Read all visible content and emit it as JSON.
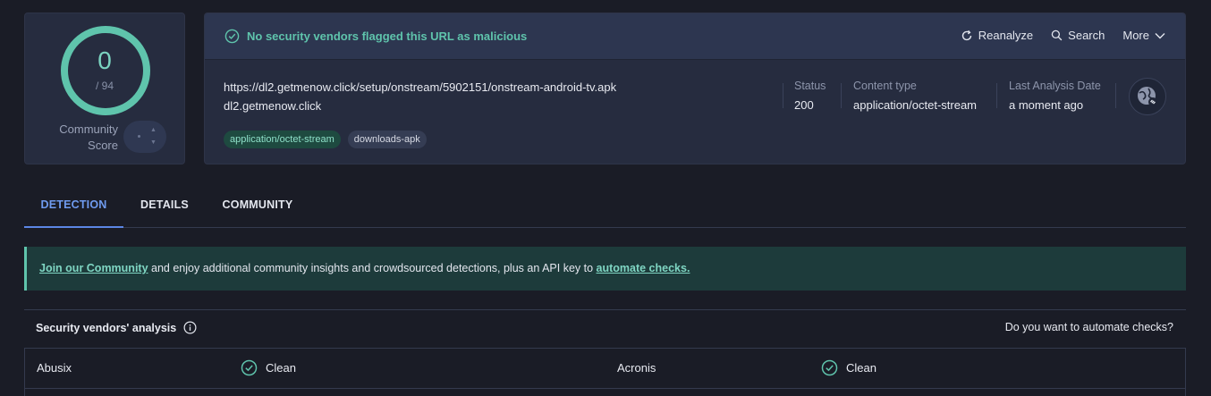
{
  "score": {
    "detections": "0",
    "total": "/ 94",
    "community_label_1": "Community",
    "community_label_2": "Score",
    "ring_color": "#5fc4ac"
  },
  "header": {
    "verdict": "No security vendors flagged this URL as malicious",
    "actions": {
      "reanalyze": "Reanalyze",
      "search": "Search",
      "more": "More"
    }
  },
  "target": {
    "url": "https://dl2.getmenow.click/setup/onstream/5902151/onstream-android-tv.apk",
    "domain": "dl2.getmenow.click",
    "tags": [
      "application/octet-stream",
      "downloads-apk"
    ]
  },
  "meta": {
    "status_label": "Status",
    "status_value": "200",
    "content_type_label": "Content type",
    "content_type_value": "application/octet-stream",
    "last_analysis_label": "Last Analysis Date",
    "last_analysis_value": "a moment ago"
  },
  "tabs": [
    "DETECTION",
    "DETAILS",
    "COMMUNITY"
  ],
  "banner": {
    "link1": "Join our Community",
    "middle": " and enjoy additional community insights and crowdsourced detections, plus an API key to ",
    "link2": "automate checks."
  },
  "vendors": {
    "title": "Security vendors' analysis",
    "automate_question": "Do you want to automate checks?",
    "rows": [
      {
        "left_name": "Abusix",
        "left_result": "Clean",
        "right_name": "Acronis",
        "right_result": "Clean"
      }
    ]
  },
  "colors": {
    "accent": "#5b86e5",
    "clean": "#5fc4ac"
  }
}
